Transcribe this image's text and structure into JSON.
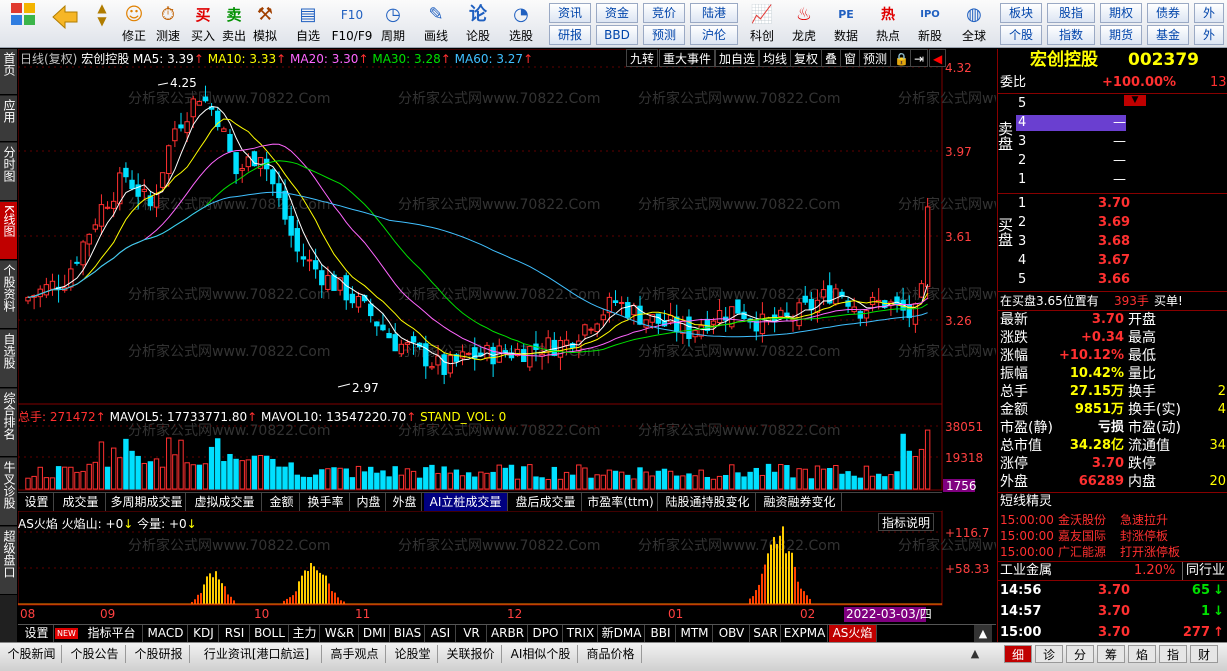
{
  "toolbar": {
    "buttons": [
      "修正",
      "测速",
      "买入",
      "卖出",
      "模拟",
      "自选",
      "F10/F9",
      "周期",
      "画线",
      "论股",
      "选股",
      "科创",
      "龙虎",
      "数据",
      "热点",
      "新股",
      "全球"
    ],
    "buy_icon": "买",
    "sell_icon": "卖",
    "f10_icon": "F10",
    "lun_icon": "论",
    "pe_icon": "PE",
    "hot_icon": "热",
    "ipo_icon": "IPO",
    "grid1": [
      "资讯",
      "资金",
      "竞价",
      "陆港",
      "研报",
      "BBD",
      "预测",
      "沪伦"
    ],
    "grid2": [
      "板块",
      "股指",
      "期权",
      "债券",
      "个股",
      "指数",
      "期货",
      "基金"
    ],
    "grid_extra": [
      "外",
      "外"
    ]
  },
  "left_tabs": [
    "首页",
    "应用",
    "分时图",
    "K线图",
    "个股资料",
    "自选股",
    "综合排名",
    "牛叉诊股",
    "超级盘口"
  ],
  "chart": {
    "ma_line": {
      "title": "日线(复权)",
      "name": "宏创控股",
      "ma5": "MA5: 3.39",
      "ma10": "MA10: 3.33",
      "ma20": "MA20: 3.30",
      "ma30": "MA30: 3.28",
      "ma60": "MA60: 3.27"
    },
    "top_buttons": [
      "九转",
      "重大事件",
      "加自选",
      "均线",
      "复权",
      "叠",
      "窗",
      "预测"
    ],
    "price_levels": [
      "4.32",
      "3.97",
      "3.61",
      "3.26"
    ],
    "high_label": "4.25",
    "low_label": "2.97",
    "watermark": "分析家公式网www.70822.Com",
    "vol_line": {
      "total": "总手: 271472",
      "mavol5": "MAVOL5: 17733771.80",
      "mavol10": "MAVOL10: 13547220.70",
      "stand": "STAND_VOL: 0"
    },
    "vol_levels": [
      "38051",
      "19318"
    ],
    "vol_badge": "1756",
    "sub_tabs": [
      "设置",
      "成交量",
      "多周期成交量",
      "虚拟成交量",
      "金额",
      "换手率",
      "内盘",
      "外盘",
      "AI立桩成交量",
      "盘后成交量",
      "市盈率(ttm)",
      "陆股通持股变化",
      "融资融券变化"
    ],
    "ind_line": {
      "name": "AS火焰",
      "f1": "火焰山: +0",
      "f2": "今量: +0"
    },
    "ind_button": "指标说明",
    "ind_levels": [
      "+116.7",
      "+58.33"
    ],
    "x_labels": [
      "08",
      "09",
      "10",
      "11",
      "12",
      "01",
      "02"
    ],
    "date_badge": "2022-03-03/四"
  },
  "ind_tabs": [
    "设置",
    "指标平台",
    "MACD",
    "KDJ",
    "RSI",
    "BOLL",
    "主力",
    "W&R",
    "DMI",
    "BIAS",
    "ASI",
    "VR",
    "ARBR",
    "DPO",
    "TRIX",
    "新DMA",
    "BBI",
    "MTM",
    "OBV",
    "SAR",
    "EXPMA",
    "AS火焰"
  ],
  "new_badge": "NEW",
  "bottom_tabs": [
    "个股新闻",
    "个股公告",
    "个股研报",
    "行业资讯[港口航运]",
    "高手观点",
    "论股堂",
    "关联报价",
    "AI相似个股",
    "商品价格"
  ],
  "bottom_right": [
    "细",
    "诊",
    "分",
    "筹",
    "焰",
    "指",
    "财"
  ],
  "right": {
    "title": "宏创控股",
    "code": "002379",
    "weibi_label": "委比",
    "weibi": "+100.00%",
    "weibi_right": "13",
    "sell_label": "卖盘",
    "buy_label": "买盘",
    "sell": [
      {
        "n": "5",
        "p": "",
        "v": ""
      },
      {
        "n": "4",
        "p": "",
        "v": "—"
      },
      {
        "n": "3",
        "p": "",
        "v": "—"
      },
      {
        "n": "2",
        "p": "",
        "v": "—"
      },
      {
        "n": "1",
        "p": "",
        "v": "—"
      }
    ],
    "buy": [
      {
        "n": "1",
        "p": "3.70"
      },
      {
        "n": "2",
        "p": "3.69"
      },
      {
        "n": "3",
        "p": "3.68"
      },
      {
        "n": "4",
        "p": "3.67"
      },
      {
        "n": "5",
        "p": "3.66"
      }
    ],
    "notice": "在买盘3.65位置有",
    "notice_vol": "393手",
    "notice_act": "买单!",
    "stats": [
      {
        "l": "最新",
        "v": "3.70",
        "l2": "开盘",
        "v2": ""
      },
      {
        "l": "涨跌",
        "v": "+0.34",
        "l2": "最高",
        "v2": ""
      },
      {
        "l": "涨幅",
        "v": "+10.12%",
        "l2": "最低",
        "v2": ""
      },
      {
        "l": "振幅",
        "v": "10.42%",
        "l2": "量比",
        "v2": ""
      },
      {
        "l": "总手",
        "v": "27.15万",
        "l2": "换手",
        "v2": "2"
      },
      {
        "l": "金额",
        "v": "9851万",
        "l2": "换手(实)",
        "v2": "4"
      },
      {
        "l": "市盈(静)",
        "v": "亏损",
        "l2": "市盈(动)",
        "v2": ""
      },
      {
        "l": "总市值",
        "v": "34.28亿",
        "l2": "流通值",
        "v2": "34"
      },
      {
        "l": "涨停",
        "v": "3.70",
        "l2": "跌停",
        "v2": ""
      },
      {
        "l": "外盘",
        "v": "66289",
        "l2": "内盘",
        "v2": "20"
      }
    ],
    "news_title": "短线精灵",
    "news": [
      {
        "t": "15:00:00",
        "s": "金沃股份",
        "e": "急速拉升"
      },
      {
        "t": "15:00:00",
        "s": "嘉友国际",
        "e": "封涨停板"
      },
      {
        "t": "15:00:00",
        "s": "广汇能源",
        "e": "打开涨停板"
      }
    ],
    "industry": "工业金属",
    "industry_pct": "1.20%",
    "industry_right": "同行业",
    "ticks": [
      {
        "t": "14:56",
        "p": "3.70",
        "v": "65"
      },
      {
        "t": "14:57",
        "p": "3.70",
        "v": "1"
      },
      {
        "t": "15:00",
        "p": "3.70",
        "v": "277"
      }
    ]
  }
}
